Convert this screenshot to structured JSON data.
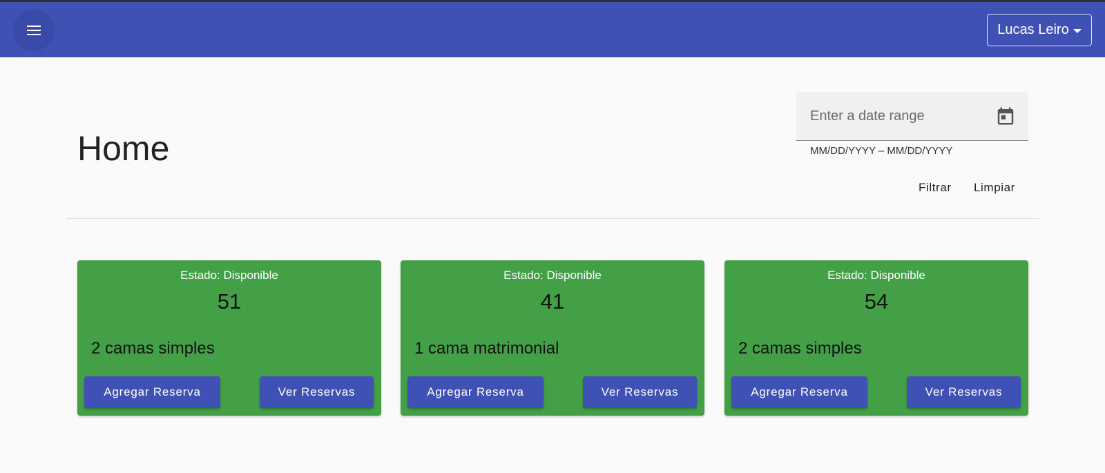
{
  "header": {
    "menu_icon": "menu-icon",
    "user_name": "Lucas Leiro",
    "brand_color": "#3f51b5"
  },
  "page": {
    "title": "Home"
  },
  "filter": {
    "date_placeholder": "Enter a date range",
    "date_hint": "MM/DD/YYYY – MM/DD/YYYY",
    "calendar_icon": "calendar-icon",
    "filter_label": "Filtrar",
    "clear_label": "Limpiar"
  },
  "rooms": [
    {
      "status": "Estado: Disponible",
      "number": "51",
      "description": "2 camas simples",
      "add_label": "Agregar Reserva",
      "view_label": "Ver Reservas"
    },
    {
      "status": "Estado: Disponible",
      "number": "41",
      "description": "1 cama matrimonial",
      "add_label": "Agregar Reserva",
      "view_label": "Ver Reservas"
    },
    {
      "status": "Estado: Disponible",
      "number": "54",
      "description": "2 camas simples",
      "add_label": "Agregar Reserva",
      "view_label": "Ver Reservas"
    }
  ],
  "colors": {
    "available": "#43a047",
    "button": "#3f51b5"
  }
}
